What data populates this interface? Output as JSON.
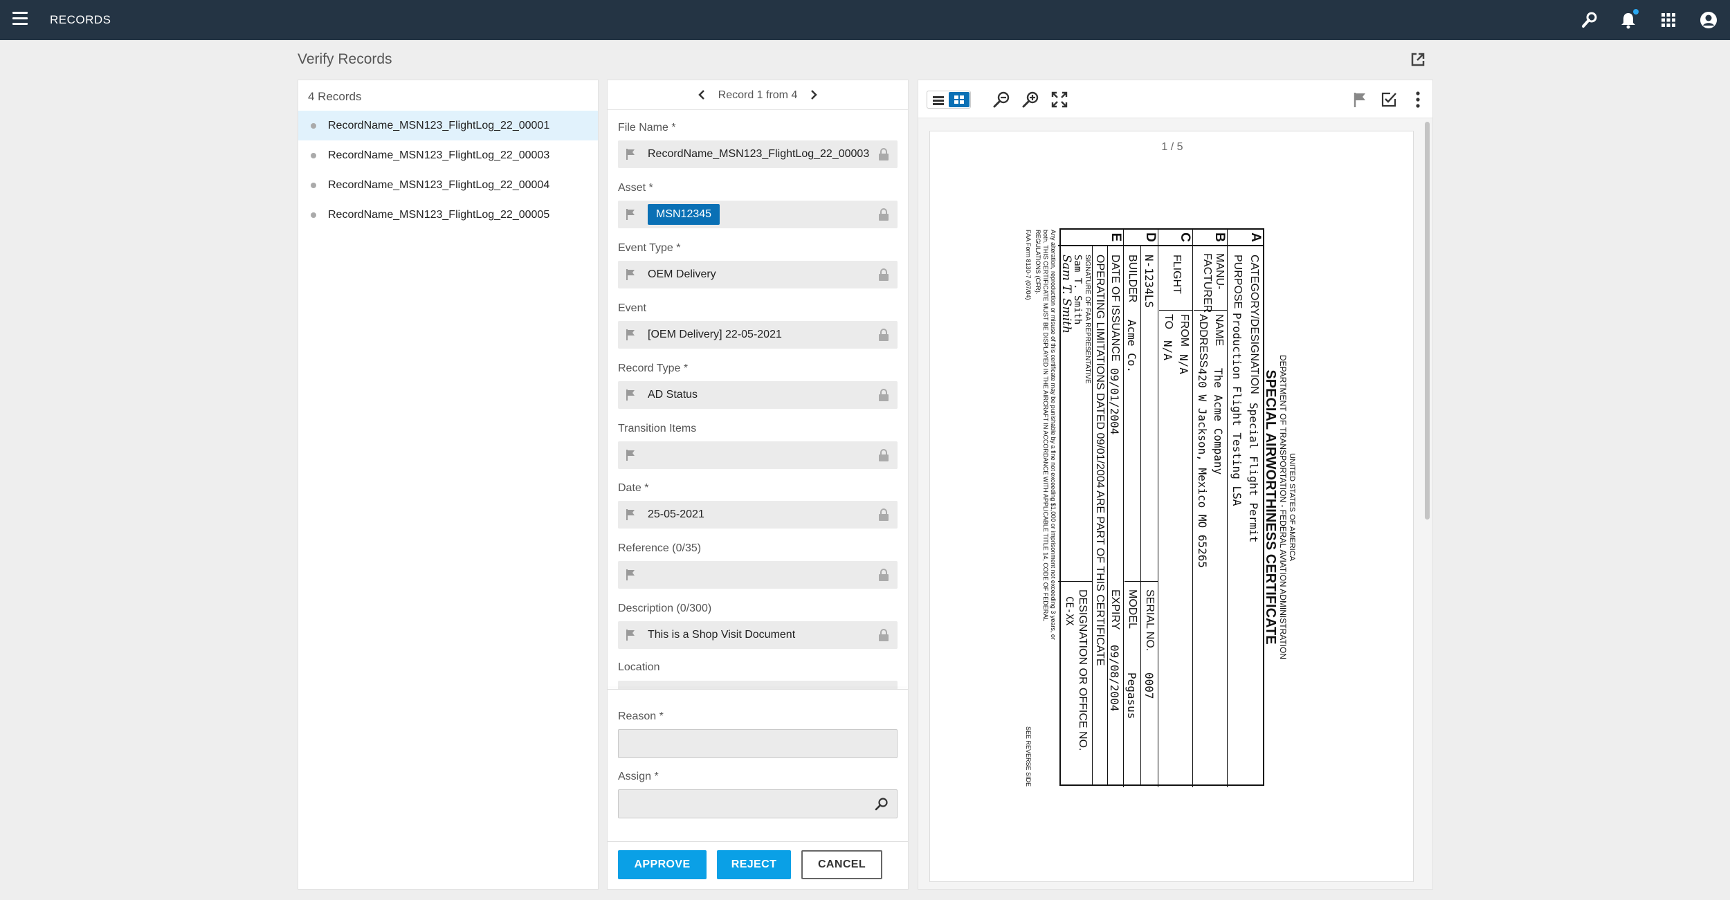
{
  "app": {
    "title": "RECORDS"
  },
  "page": {
    "title": "Verify Records"
  },
  "records": {
    "count_label": "4 Records",
    "items": [
      {
        "label": "RecordName_MSN123_FlightLog_22_00001",
        "active": true
      },
      {
        "label": "RecordName_MSN123_FlightLog_22_00003",
        "active": false
      },
      {
        "label": "RecordName_MSN123_FlightLog_22_00004",
        "active": false
      },
      {
        "label": "RecordName_MSN123_FlightLog_22_00005",
        "active": false
      }
    ]
  },
  "form": {
    "pager": "Record 1 from 4",
    "file_name_label": "File Name *",
    "file_name_value": "RecordName_MSN123_FlightLog_22_00003",
    "asset_label": "Asset *",
    "asset_value": "MSN12345",
    "event_type_label": "Event Type *",
    "event_type_value": "OEM Delivery",
    "event_label": "Event",
    "event_value": "[OEM Delivery] 22-05-2021",
    "record_type_label": "Record Type *",
    "record_type_value": "AD Status",
    "transition_label": "Transition Items",
    "transition_value": "",
    "date_label": "Date *",
    "date_value": "25-05-2021",
    "reference_label": "Reference  (0/35)",
    "reference_value": "",
    "description_label": "Description  (0/300)",
    "description_value": "This is a Shop Visit Document",
    "location_label": "Location",
    "reason_label": "Reason *",
    "reason_value": "",
    "assign_label": "Assign *",
    "assign_value": ""
  },
  "actions": {
    "approve": "APPROVE",
    "reject": "REJECT",
    "cancel": "CANCEL"
  },
  "viewer": {
    "page_count": "1 / 5",
    "document": {
      "header1": "UNITED STATES OF AMERICA",
      "header2": "DEPARTMENT OF TRANSPORTATION - FEDERAL AVIATION ADMINISTRATION",
      "title": "SPECIAL AIRWORTHINESS CERTIFICATE",
      "a_letter": "A",
      "a_label1": "CATEGORY/DESIGNATION",
      "a_value1": "Special Flight Permit",
      "a_label2": "PURPOSE",
      "a_value2": "Production Flight Testing LSA",
      "b_letter": "B",
      "b_label": "MANU-\nFACTURER",
      "b_name_label": "NAME",
      "b_name_value": "The Acme Company",
      "b_addr_label": "ADDRESS",
      "b_addr_value": "420 W Jackson, Mexico MO 65265",
      "c_letter": "C",
      "c_label": "FLIGHT",
      "c_from_label": "FROM",
      "c_from_value": "N/A",
      "c_to_label": "TO",
      "c_to_value": "N/A",
      "d_letter": "D",
      "d_nnum": "N-1234LS",
      "d_serial_label": "SERIAL NO.",
      "d_serial_value": "0007",
      "d_builder_label": "BUILDER",
      "d_builder_value": "Acme Co.",
      "d_model_label": "MODEL",
      "d_model_value": "Pegasus",
      "e_letter": "E",
      "e_issue_label": "DATE OF ISSUANCE",
      "e_issue_value": "09/01/2004",
      "e_expiry_label": "EXPIRY",
      "e_expiry_value": "09/08/2004",
      "e_ops": "OPERATING LIMITATIONS DATED 09/01/2004 ARE PART OF THIS CERTIFICATE",
      "e_sig_label": "SIGNATURE OF FAA REPRESENTATIVE",
      "e_sig_value": "Sam T. Smith",
      "e_sig_script": "Sam T. Smith",
      "e_desig_label": "DESIGNATION OR OFFICE NO.",
      "e_desig_value": "CE-XX",
      "footer1": "Any alteration, reproduction or misuse of this certificate may be punishable by a fine not exceeding $1,000 or imprisonment not exceeding 3 years, or",
      "footer2": "both. THIS CERTIFICATE MUST BE DISPLAYED IN THE AIRCRAFT IN ACCORDANCE WITH APPLICABLE TITLE 14, CODE OF FEDERAL",
      "footer3": "REGULATIONS (CFR).",
      "form_no": "FAA Form 8130-7 (07/04)",
      "see_reverse": "SEE REVERSE SIDE"
    }
  }
}
